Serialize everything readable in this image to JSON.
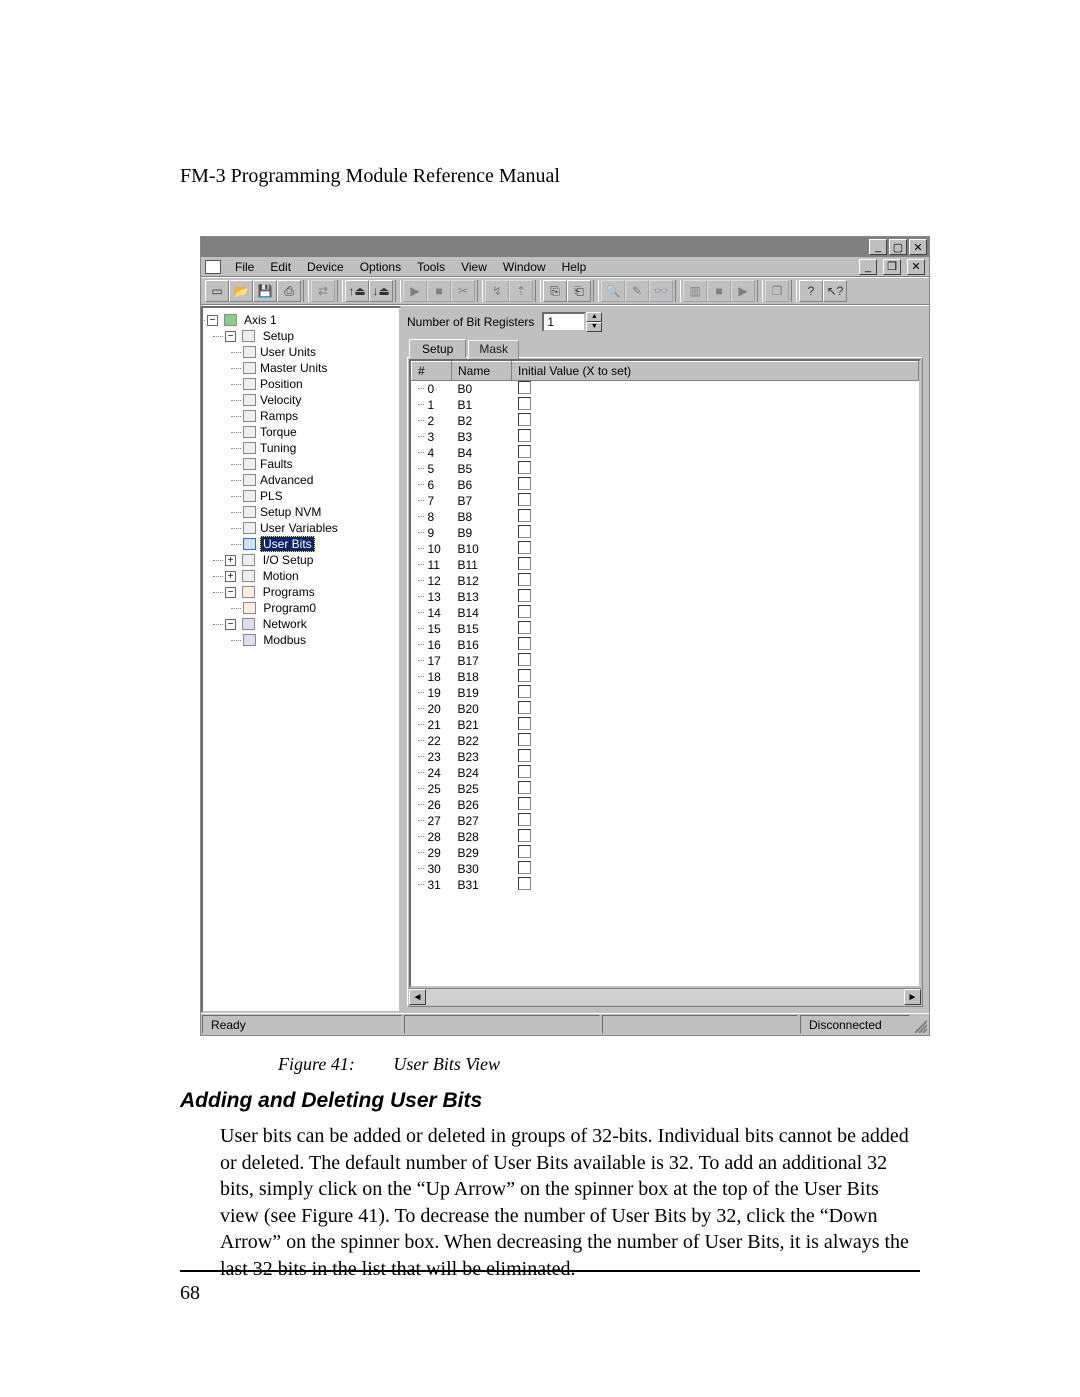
{
  "doc": {
    "header": "FM-3 Programming Module Reference Manual",
    "page_number": "68",
    "figure_label": "Figure 41:",
    "figure_title": "User Bits View",
    "section_heading": "Adding and Deleting User Bits",
    "body": "User bits can be added or deleted in groups of 32-bits. Individual bits cannot be added or deleted. The default number of User Bits available is 32. To add an additional 32 bits, simply click on the “Up Arrow” on the spinner box at the top of the User Bits view (see Figure 41). To decrease the number of User Bits by 32, click the “Down Arrow” on the spinner box. When decreasing the number of User Bits, it is always the last 32 bits in the list that will be eliminated."
  },
  "win": {
    "title_controls": {
      "min": "_",
      "max": "▢",
      "close": "✕"
    },
    "doc_controls": {
      "min": "_",
      "restore": "❐",
      "close": "✕"
    }
  },
  "menubar": [
    "File",
    "Edit",
    "Device",
    "Options",
    "Tools",
    "View",
    "Window",
    "Help"
  ],
  "statusbar": {
    "ready": "Ready",
    "conn": "Disconnected"
  },
  "tree": {
    "root": "Axis 1",
    "setup": "Setup",
    "setup_children": [
      "User Units",
      "Master Units",
      "Position",
      "Velocity",
      "Ramps",
      "Torque",
      "Tuning",
      "Faults",
      "Advanced",
      "PLS",
      "Setup NVM",
      "User Variables",
      "User Bits"
    ],
    "selected": "User Bits",
    "io": "I/O Setup",
    "motion": "Motion",
    "programs": "Programs",
    "program0": "Program0",
    "network": "Network",
    "modbus": "Modbus"
  },
  "userbits": {
    "spinner_label": "Number of Bit Registers",
    "spinner_value": "1",
    "tabs": {
      "setup": "Setup",
      "mask": "Mask"
    },
    "cols": {
      "num": "#",
      "name": "Name",
      "init": "Initial Value (X to set)"
    },
    "rows": [
      {
        "n": "0",
        "name": "B0"
      },
      {
        "n": "1",
        "name": "B1"
      },
      {
        "n": "2",
        "name": "B2"
      },
      {
        "n": "3",
        "name": "B3"
      },
      {
        "n": "4",
        "name": "B4"
      },
      {
        "n": "5",
        "name": "B5"
      },
      {
        "n": "6",
        "name": "B6"
      },
      {
        "n": "7",
        "name": "B7"
      },
      {
        "n": "8",
        "name": "B8"
      },
      {
        "n": "9",
        "name": "B9"
      },
      {
        "n": "10",
        "name": "B10"
      },
      {
        "n": "11",
        "name": "B11"
      },
      {
        "n": "12",
        "name": "B12"
      },
      {
        "n": "13",
        "name": "B13"
      },
      {
        "n": "14",
        "name": "B14"
      },
      {
        "n": "15",
        "name": "B15"
      },
      {
        "n": "16",
        "name": "B16"
      },
      {
        "n": "17",
        "name": "B17"
      },
      {
        "n": "18",
        "name": "B18"
      },
      {
        "n": "19",
        "name": "B19"
      },
      {
        "n": "20",
        "name": "B20"
      },
      {
        "n": "21",
        "name": "B21"
      },
      {
        "n": "22",
        "name": "B22"
      },
      {
        "n": "23",
        "name": "B23"
      },
      {
        "n": "24",
        "name": "B24"
      },
      {
        "n": "25",
        "name": "B25"
      },
      {
        "n": "26",
        "name": "B26"
      },
      {
        "n": "27",
        "name": "B27"
      },
      {
        "n": "28",
        "name": "B28"
      },
      {
        "n": "29",
        "name": "B29"
      },
      {
        "n": "30",
        "name": "B30"
      },
      {
        "n": "31",
        "name": "B31"
      }
    ]
  }
}
